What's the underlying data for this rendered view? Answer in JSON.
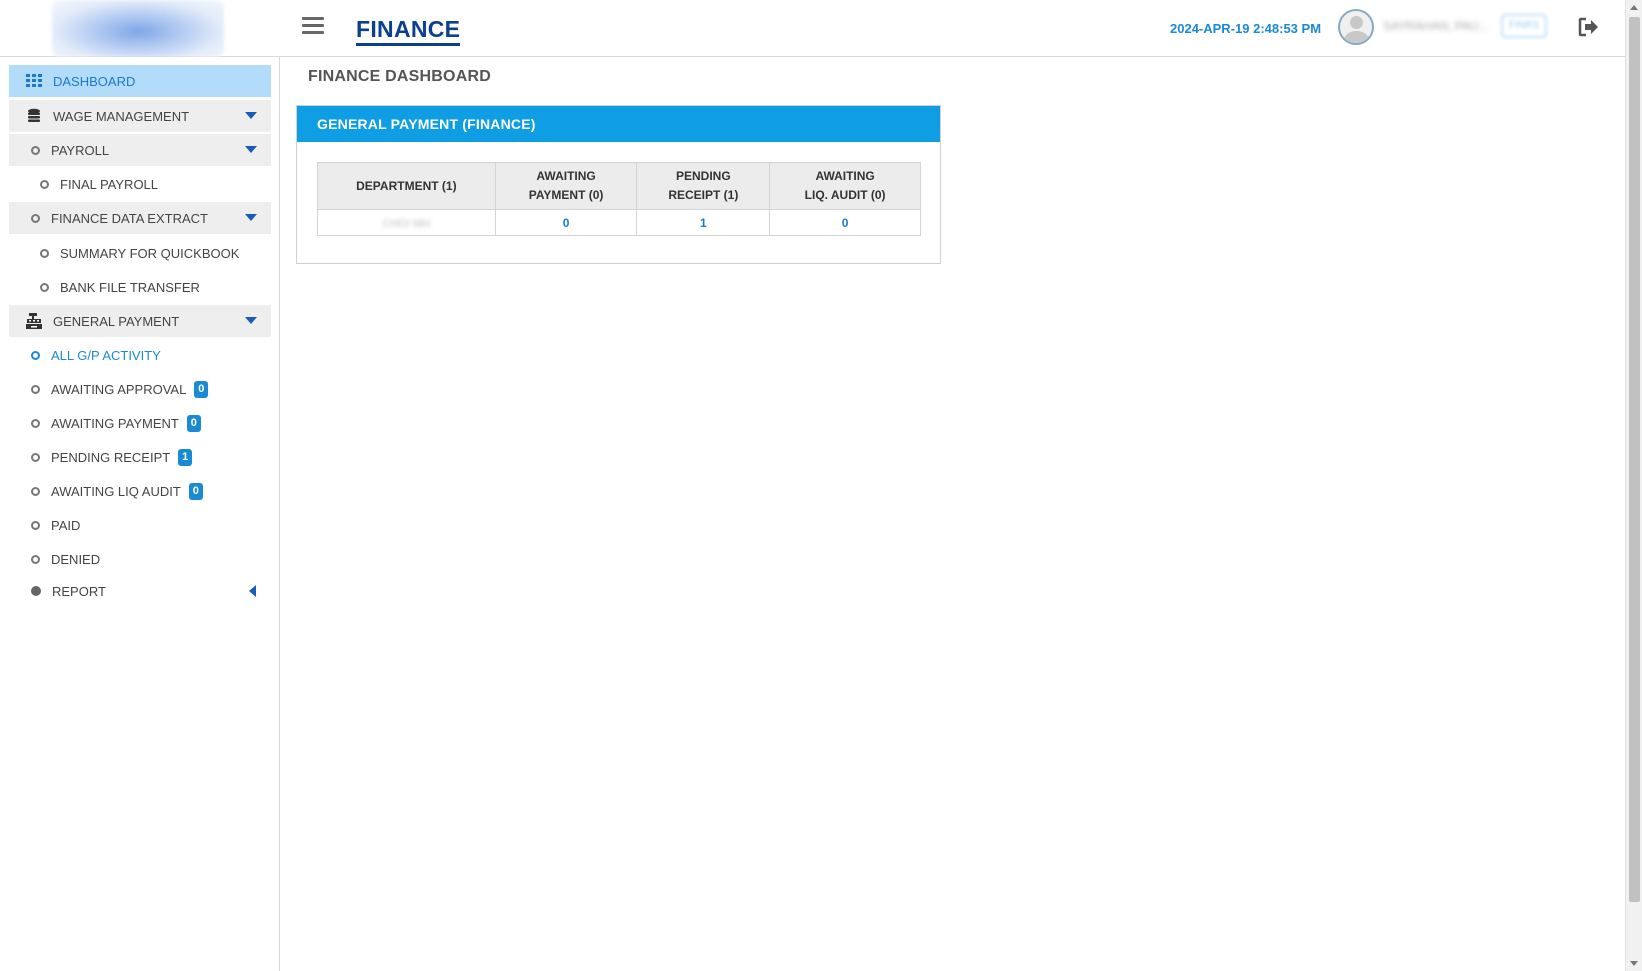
{
  "header": {
    "app_title": "FINANCE",
    "clock": "2024-APR-19 2:48:53 PM",
    "user_name": "SAYRAHAN, PAU...",
    "role": "FINRS"
  },
  "sidebar": {
    "dashboard": "DASHBOARD",
    "wage_management": "WAGE MANAGEMENT",
    "payroll": "PAYROLL",
    "final_payroll": "FINAL PAYROLL",
    "finance_data_extract": "FINANCE DATA EXTRACT",
    "summary_for_quickbook": "SUMMARY FOR QUICKBOOK",
    "bank_file_transfer": "BANK FILE TRANSFER",
    "general_payment": "GENERAL PAYMENT",
    "all_gp_activity": "ALL G/P ACTIVITY",
    "awaiting_approval": "AWAITING APPROVAL",
    "awaiting_approval_count": "0",
    "awaiting_payment": "AWAITING PAYMENT",
    "awaiting_payment_count": "0",
    "pending_receipt": "PENDING RECEIPT",
    "pending_receipt_count": "1",
    "awaiting_liq_audit": "AWAITING LIQ AUDIT",
    "awaiting_liq_audit_count": "0",
    "paid": "PAID",
    "denied": "DENIED",
    "report": "REPORT"
  },
  "main": {
    "page_title": "FINANCE DASHBOARD",
    "panel_title": "GENERAL PAYMENT (FINANCE)",
    "table": {
      "headers": [
        "DEPARTMENT (1)",
        "AWAITING",
        "PAYMENT (0)",
        "PENDING",
        "RECEIPT (1)",
        "AWAITING",
        "LIQ. AUDIT (0)"
      ],
      "row": {
        "department": "CHO/ MH",
        "awaiting_payment": "0",
        "pending_receipt": "1",
        "awaiting_liq_audit": "0"
      }
    }
  },
  "colors": {
    "brand_navy": "#0b3f8f",
    "accent_blue": "#1a8ad4",
    "panel_header": "#0f9ee3",
    "active_nav": "#b3dcfb"
  }
}
